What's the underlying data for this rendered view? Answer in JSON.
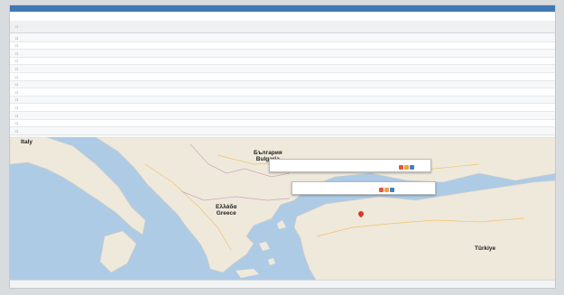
{
  "map": {
    "labels": {
      "italy": "Italy",
      "turkey": "Türkiye",
      "bulgaria": "България\nBulgaria",
      "greece": "Ελλάδα\nGreece"
    }
  },
  "colors": {
    "topbar": "#3f78b5",
    "link": "#2d6fb6",
    "sea": "#aecbe6",
    "land": "#efe9dc",
    "pin": "#d9372b",
    "btn_red": "#e05a3c",
    "btn_orange": "#f0a23a",
    "btn_blue": "#3f7fcf"
  },
  "icons": [
    "checkbox-icon",
    "map-pin-icon",
    "close-icon"
  ]
}
